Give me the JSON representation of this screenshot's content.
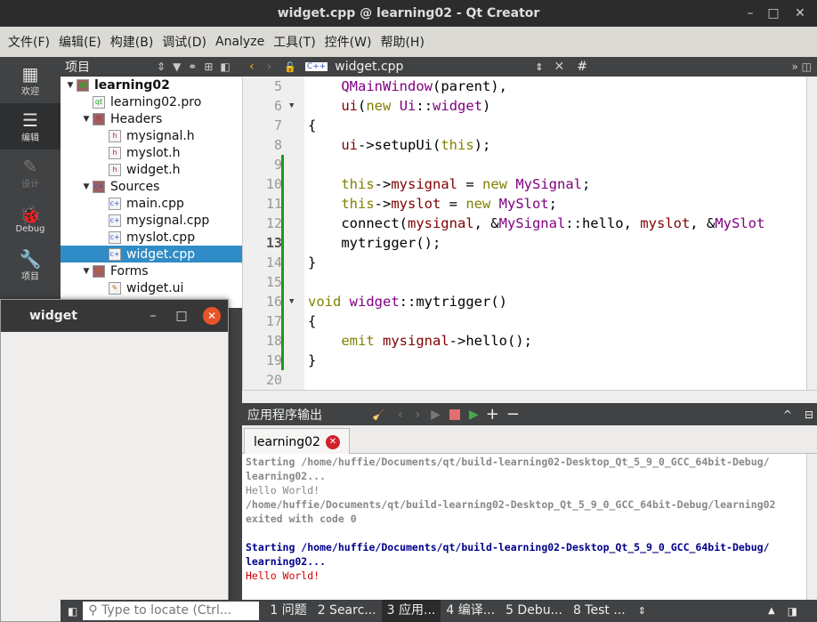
{
  "window": {
    "title": "widget.cpp @ learning02 - Qt Creator",
    "minimize": "–",
    "maximize": "□",
    "close": "✕"
  },
  "menu": [
    "文件(F)",
    "编辑(E)",
    "构建(B)",
    "调试(D)",
    "Analyze",
    "工具(T)",
    "控件(W)",
    "帮助(H)"
  ],
  "modes": [
    {
      "label": "欢迎",
      "icon": "▦"
    },
    {
      "label": "编辑",
      "icon": "☰"
    },
    {
      "label": "设计",
      "icon": "✎"
    },
    {
      "label": "Debug",
      "icon": "🐞"
    },
    {
      "label": "项目",
      "icon": "🔧"
    }
  ],
  "project": {
    "header": "项目",
    "tree": [
      {
        "label": "learning02",
        "level": 0,
        "arrow": "▼",
        "icon": "qt",
        "bold": true
      },
      {
        "label": "learning02.pro",
        "level": 1,
        "arrow": "",
        "icon": "pro"
      },
      {
        "label": "Headers",
        "level": 1,
        "arrow": "▼",
        "icon": "h-folder"
      },
      {
        "label": "mysignal.h",
        "level": 2,
        "arrow": "",
        "icon": "h"
      },
      {
        "label": "myslot.h",
        "level": 2,
        "arrow": "",
        "icon": "h"
      },
      {
        "label": "widget.h",
        "level": 2,
        "arrow": "",
        "icon": "h"
      },
      {
        "label": "Sources",
        "level": 1,
        "arrow": "▼",
        "icon": "cpp-folder"
      },
      {
        "label": "main.cpp",
        "level": 2,
        "arrow": "",
        "icon": "cpp"
      },
      {
        "label": "mysignal.cpp",
        "level": 2,
        "arrow": "",
        "icon": "cpp"
      },
      {
        "label": "myslot.cpp",
        "level": 2,
        "arrow": "",
        "icon": "cpp"
      },
      {
        "label": "widget.cpp",
        "level": 2,
        "arrow": "",
        "icon": "cpp",
        "selected": true
      },
      {
        "label": "Forms",
        "level": 1,
        "arrow": "▼",
        "icon": "ui-folder"
      },
      {
        "label": "widget.ui",
        "level": 2,
        "arrow": "",
        "icon": "ui"
      }
    ]
  },
  "editor": {
    "file": "widget.cpp",
    "symbol": "#",
    "current_line": 13,
    "lines": [
      {
        "n": 5,
        "t": [
          [
            "    ",
            ""
          ],
          [
            "QMainWindow",
            "ty"
          ],
          [
            "(parent),",
            ""
          ]
        ]
      },
      {
        "n": 6,
        "fold": true,
        "t": [
          [
            "    ",
            ""
          ],
          [
            "ui",
            "mb"
          ],
          [
            "(",
            ""
          ],
          [
            "new",
            "kw"
          ],
          [
            " ",
            ""
          ],
          [
            "Ui",
            "ty"
          ],
          [
            "::",
            ""
          ],
          [
            "widget",
            "ty"
          ],
          [
            ")",
            ""
          ]
        ]
      },
      {
        "n": 7,
        "t": [
          [
            "{",
            ""
          ]
        ]
      },
      {
        "n": 8,
        "t": [
          [
            "    ",
            ""
          ],
          [
            "ui",
            "mb"
          ],
          [
            "->setupUi(",
            ""
          ],
          [
            "this",
            "kw"
          ],
          [
            ");",
            ""
          ]
        ]
      },
      {
        "n": 9,
        "t": []
      },
      {
        "n": 10,
        "t": [
          [
            "    ",
            ""
          ],
          [
            "this",
            "kw"
          ],
          [
            "->",
            ""
          ],
          [
            "mysignal",
            "mb"
          ],
          [
            " = ",
            ""
          ],
          [
            "new",
            "kw"
          ],
          [
            " ",
            ""
          ],
          [
            "MySignal",
            "ty"
          ],
          [
            ";",
            ""
          ]
        ]
      },
      {
        "n": 11,
        "t": [
          [
            "    ",
            ""
          ],
          [
            "this",
            "kw"
          ],
          [
            "->",
            ""
          ],
          [
            "myslot",
            "mb"
          ],
          [
            " = ",
            ""
          ],
          [
            "new",
            "kw"
          ],
          [
            " ",
            ""
          ],
          [
            "MySlot",
            "ty"
          ],
          [
            ";",
            ""
          ]
        ]
      },
      {
        "n": 12,
        "t": [
          [
            "    connect(",
            ""
          ],
          [
            "mysignal",
            "mb"
          ],
          [
            ", &",
            ""
          ],
          [
            "MySignal",
            "ty"
          ],
          [
            "::hello, ",
            ""
          ],
          [
            "myslot",
            "mb"
          ],
          [
            ", &",
            ""
          ],
          [
            "MySlot",
            "ty"
          ]
        ]
      },
      {
        "n": 13,
        "t": [
          [
            "    mytrigger();",
            ""
          ]
        ]
      },
      {
        "n": 14,
        "t": [
          [
            "}",
            ""
          ]
        ]
      },
      {
        "n": 15,
        "t": []
      },
      {
        "n": 16,
        "fold": true,
        "t": [
          [
            "void",
            "kw"
          ],
          [
            " ",
            ""
          ],
          [
            "widget",
            "ty"
          ],
          [
            "::mytrigger()",
            ""
          ]
        ]
      },
      {
        "n": 17,
        "t": [
          [
            "{",
            ""
          ]
        ]
      },
      {
        "n": 18,
        "t": [
          [
            "    ",
            ""
          ],
          [
            "emit",
            "kw"
          ],
          [
            " ",
            ""
          ],
          [
            "mysignal",
            "mb"
          ],
          [
            "->hello();",
            ""
          ]
        ]
      },
      {
        "n": 19,
        "t": [
          [
            "}",
            ""
          ]
        ]
      },
      {
        "n": 20,
        "t": []
      }
    ]
  },
  "output": {
    "title": "应用程序输出",
    "tab": "learning02",
    "lines": [
      {
        "text": "Starting /home/huffie/Documents/qt/build-learning02-Desktop_Qt_5_9_0_GCC_64bit-Debug/",
        "style": "og"
      },
      {
        "text": "learning02...",
        "style": "og"
      },
      {
        "text": "Hello World!",
        "style": "ogl"
      },
      {
        "text": "/home/huffie/Documents/qt/build-learning02-Desktop_Qt_5_9_0_GCC_64bit-Debug/learning02",
        "style": "og"
      },
      {
        "text": "exited with code 0",
        "style": "og"
      },
      {
        "text": "",
        "style": ""
      },
      {
        "text": "Starting /home/huffie/Documents/qt/build-learning02-Desktop_Qt_5_9_0_GCC_64bit-Debug/",
        "style": "ob"
      },
      {
        "text": "learning02...",
        "style": "ob"
      },
      {
        "text": "Hello World!",
        "style": "or"
      }
    ]
  },
  "widget_window": {
    "title": "widget"
  },
  "status": {
    "locate_placeholder": "Type to locate (Ctrl...",
    "panes": [
      "1 问题",
      "2 Searc...",
      "3 应用...",
      "4 编译...",
      "5 Debu...",
      "8 Test ..."
    ],
    "active_pane": 2
  },
  "colors": {
    "keyword": "#808000",
    "type": "#800080",
    "member": "#800000",
    "selection": "#308cc6",
    "close": "#e8542a"
  }
}
